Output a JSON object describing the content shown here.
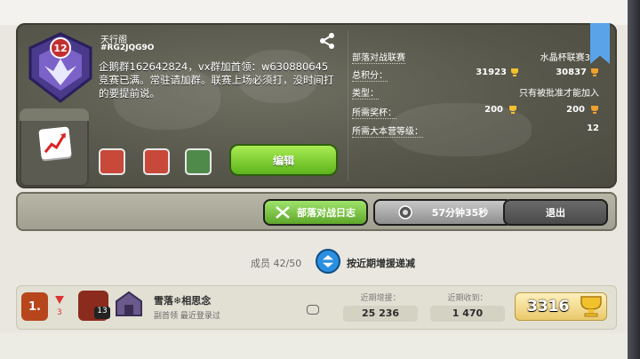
{
  "clan": {
    "level": "12",
    "name": "天行阁",
    "tag": "#RG2JQG9O",
    "description": "企鹅群162642824，vx群加首领：w630880645 竞赛已满。常驻请加群。联赛上场必须打，没时间打的要提前说。",
    "edit_label": "编辑"
  },
  "stats": {
    "war_league_label": "部落对战联赛",
    "war_league_value": "水晶杯联赛3",
    "total_points_label": "总积分：",
    "total_points_a": "31923",
    "total_points_b": "30837",
    "type_label": "类型：",
    "type_value": "只有被批准才能加入",
    "required_trophies_label": "所需奖杯：",
    "required_trophies_a": "200",
    "required_trophies_b": "200",
    "required_th_label": "所需大本营等级：",
    "required_th_value": "12"
  },
  "tabs": {
    "war_log": "部落对战日志",
    "timer": "57分钟35秒",
    "leave": "退出"
  },
  "members": {
    "count_label": "成员 42/50",
    "sort_label": "按近期增援递减"
  },
  "member_row": {
    "rank": "1.",
    "rank_change": "3",
    "th_level": "13",
    "name": "雪落❄相思念",
    "role": "副首领 最近登录过",
    "donated_label": "近期增援：",
    "donated_value": "25 236",
    "received_label": "近期收到：",
    "received_value": "1 470",
    "trophies": "3316"
  },
  "colors": {
    "edit_button": "#6cc42a",
    "war_log_button": "#7fcd4a",
    "sort_button": "#2a8fe0",
    "trophy_gold": "#e9c868"
  }
}
